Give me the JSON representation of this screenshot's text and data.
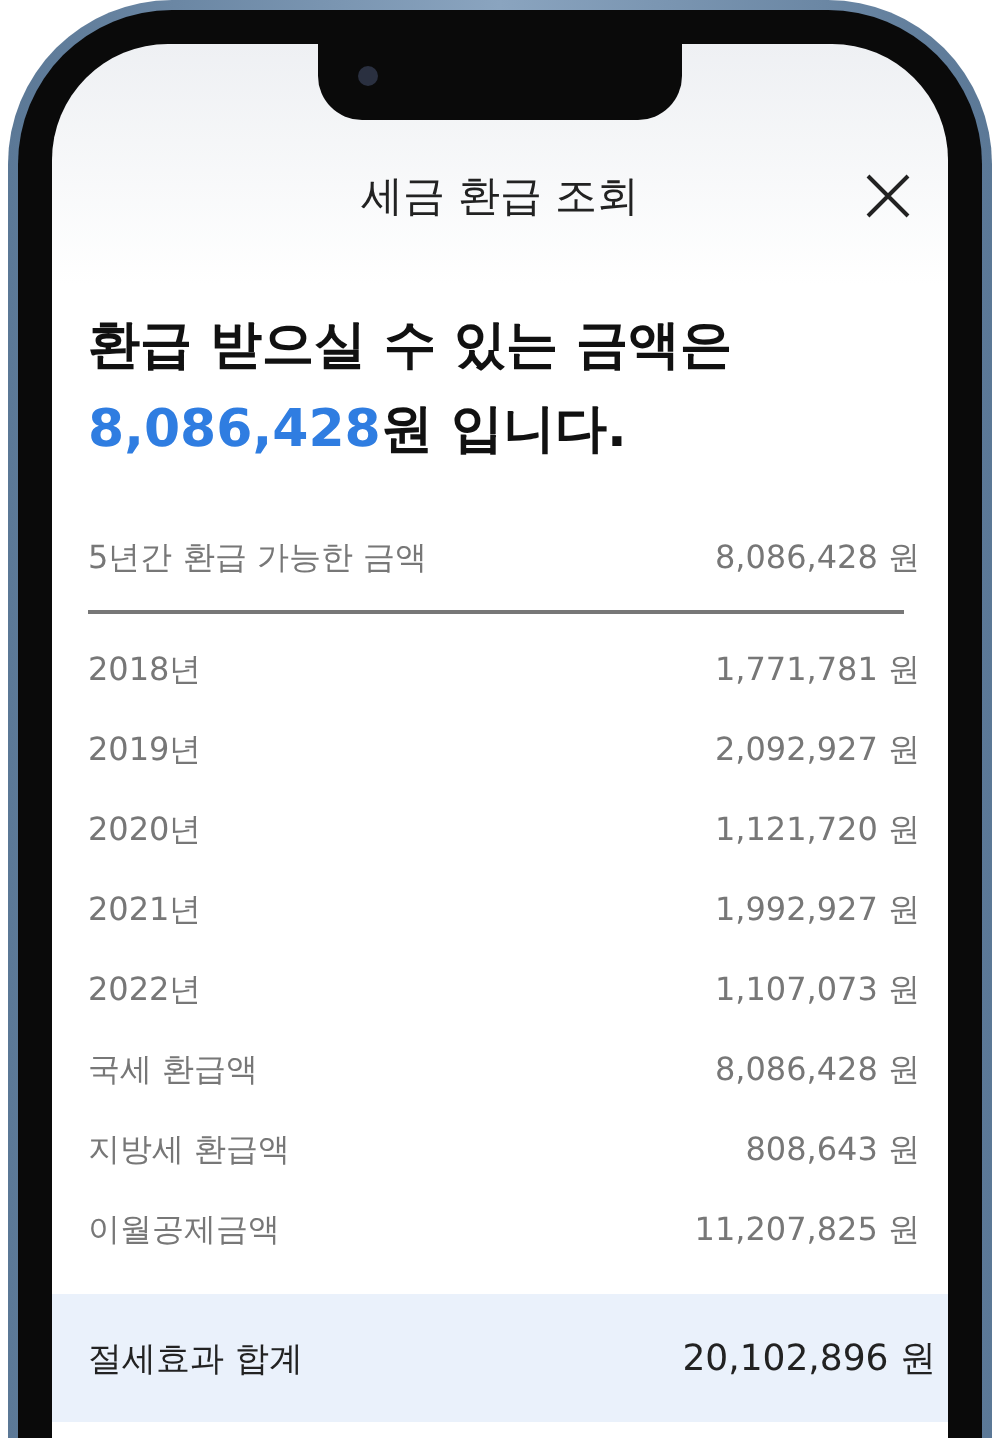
{
  "header": {
    "title": "세금 환급 조회"
  },
  "headline": {
    "line1": "환급 받으실 수 있는 금액은",
    "amount": "8,086,428",
    "suffix": "원 입니다."
  },
  "summary": {
    "label": "5년간 환급 가능한 금액",
    "value": "8,086,428 원"
  },
  "rows": [
    {
      "label": "2018년",
      "value": "1,771,781 원"
    },
    {
      "label": "2019년",
      "value": "2,092,927 원"
    },
    {
      "label": "2020년",
      "value": "1,121,720 원"
    },
    {
      "label": "2021년",
      "value": "1,992,927 원"
    },
    {
      "label": "2022년",
      "value": "1,107,073 원"
    },
    {
      "label": "국세 환급액",
      "value": "8,086,428 원"
    },
    {
      "label": "지방세 환급액",
      "value": "808,643 원"
    },
    {
      "label": "이월공제금액",
      "value": "11,207,825 원"
    }
  ],
  "total": {
    "label": "절세효과 합계",
    "value": "20,102,896 원"
  }
}
